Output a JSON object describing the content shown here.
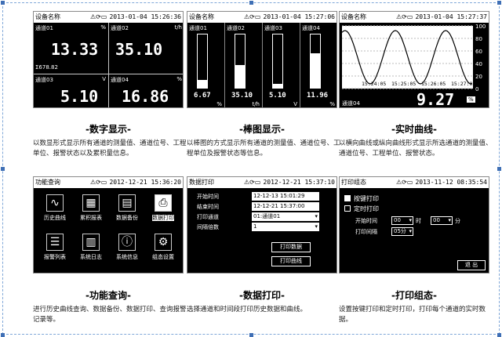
{
  "panels": {
    "digital": {
      "header": {
        "title": "设备名称",
        "icons": "⚠⟳▭",
        "datetime": "2013-01-04 15:26:36"
      },
      "cells": [
        {
          "name": "通道01",
          "unit": "%",
          "value": "13.33"
        },
        {
          "name": "通道02",
          "unit": "t/h",
          "value": "35.10"
        },
        {
          "name": "通道03",
          "unit": "V",
          "value": "5.10"
        },
        {
          "name": "通道04",
          "unit": "%",
          "value": "16.86"
        }
      ],
      "total": "Σ678.82",
      "caption": "-数字显示-",
      "description": "以数显形式显示所有通道的测量值、通道位号、工程单位、报警状态以及累积量信息。"
    },
    "bar": {
      "header": {
        "title": "设备名称",
        "icons": "⚠⟳▭",
        "datetime": "2013-01-04 15:27:06"
      },
      "bars": [
        {
          "name": "通道01",
          "value": "6.67",
          "unit": "%",
          "fill": 0.14
        },
        {
          "name": "通道02",
          "value": "35.10",
          "unit": "t/h",
          "fill": 0.42
        },
        {
          "name": "通道03",
          "value": "5.10",
          "unit": "V",
          "fill": 0.07
        },
        {
          "name": "通道04",
          "value": "11.96",
          "unit": "%",
          "fill": 0.65
        }
      ],
      "caption": "-棒图显示-",
      "description": "以棒图的方式显示所有通道的测量值、通道位号、工程单位及报警状态等信息。"
    },
    "curve": {
      "header": {
        "title": "设备名称",
        "icons": "⚠⟳▭",
        "datetime": "2013-01-04 15:27:37"
      },
      "y_ticks": [
        "100",
        "80",
        "60",
        "40",
        "20",
        "0"
      ],
      "time_ticks": [
        "15:24:05",
        "15:25:05",
        "15:26:05",
        "15:27:05"
      ],
      "channel": "通道04",
      "value": "9.27",
      "unit": "%",
      "caption": "-实时曲线-",
      "description": "以横向曲线或纵向曲线形式显示所选通道的测量值、通道位号、工程单位、报警状态。"
    },
    "function": {
      "header": {
        "title": "功能查询",
        "icons": "⚠⟳▭",
        "datetime": "2012-12-21 15:36:20"
      },
      "buttons": [
        {
          "label": "历史曲线",
          "glyph": "∿",
          "icon": "history-curve-icon"
        },
        {
          "label": "累积报表",
          "glyph": "▦",
          "icon": "report-icon"
        },
        {
          "label": "数据备份",
          "glyph": "▤",
          "icon": "backup-icon"
        },
        {
          "label": "数据打印",
          "glyph": "⎙",
          "icon": "printer-icon",
          "selected": true
        },
        {
          "label": "报警列表",
          "glyph": "☰",
          "icon": "alarm-list-icon"
        },
        {
          "label": "系统日志",
          "glyph": "▥",
          "icon": "log-icon"
        },
        {
          "label": "系统信息",
          "glyph": "ⓘ",
          "icon": "info-icon"
        },
        {
          "label": "组态设置",
          "glyph": "⚙",
          "icon": "gear-icon"
        }
      ],
      "caption": "-功能查询-",
      "description": "进行历史曲线查询、数据备份、数据打印、查询报警记录等。"
    },
    "print": {
      "header": {
        "title": "数据打印",
        "icons": "⚠⟳▭",
        "datetime": "2012-12-21 15:37:10"
      },
      "rows": [
        {
          "label": "开始时间",
          "value": "12-12-13 15:01:29"
        },
        {
          "label": "结束时间",
          "value": "12-12-21 15:37:00"
        },
        {
          "label": "打印通道",
          "value": "01:通道01"
        },
        {
          "label": "间隔倍数",
          "value": "1"
        }
      ],
      "btn_data": "打印数据",
      "btn_curve": "打印曲线",
      "caption": "-数据打印-",
      "description": "选择通道和时间段打印历史数据和曲线。"
    },
    "printcfg": {
      "header": {
        "title": "打印组态",
        "icons": "⚠⟳▭",
        "datetime": "2013-11-12 08:35:54"
      },
      "opt_key": "按键打印",
      "opt_timer": "定时打印",
      "start_label": "开始时间",
      "hour": "00",
      "hour_unit": "时",
      "minute": "00",
      "minute_unit": "分",
      "interval_label": "打印间隔",
      "interval": "05分",
      "exit": "退 出",
      "caption": "-打印组态-",
      "description": "设置按键打印和定时打印，打印每个通道的实时数据。"
    }
  }
}
